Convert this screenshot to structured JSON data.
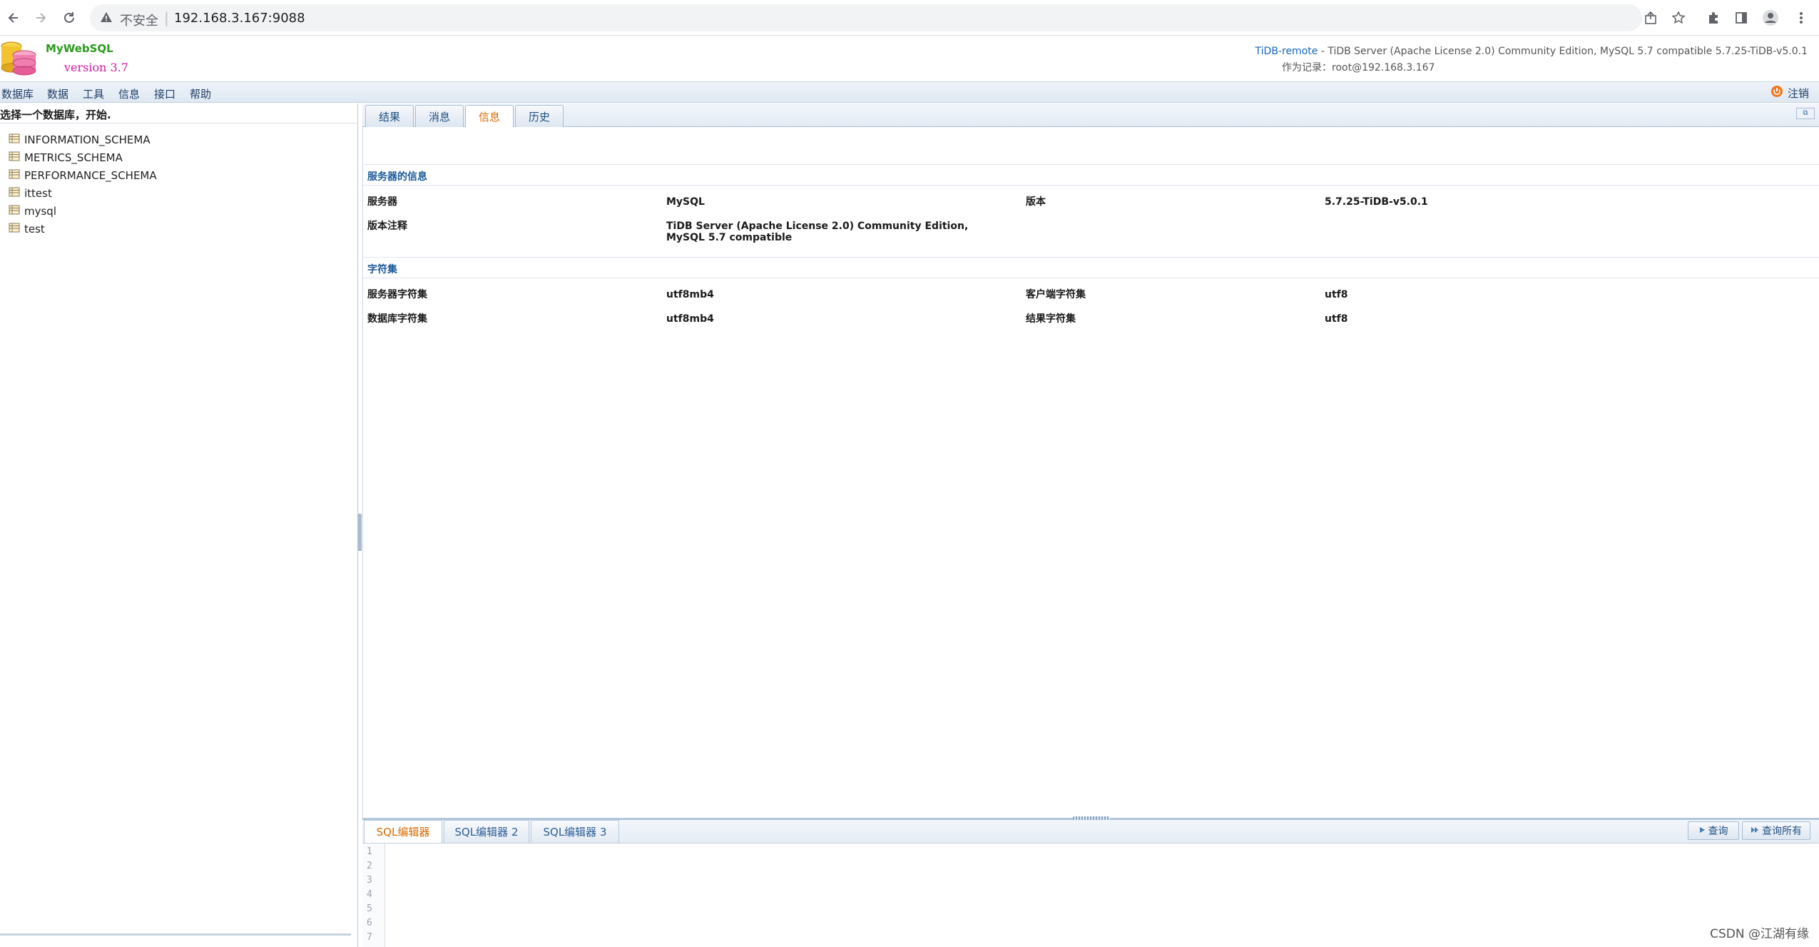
{
  "browser": {
    "insecure_label": "不安全",
    "url": "192.168.3.167:9088"
  },
  "app": {
    "name": "MyWebSQL",
    "version": "version 3.7",
    "connection_name": "TiDB-remote",
    "connection_desc": " - TiDB Server (Apache License 2.0) Community Edition, MySQL 5.7 compatible 5.7.25-TiDB-v5.0.1",
    "logged_in_as": "作为记录：root@192.168.3.167"
  },
  "menu": {
    "items": [
      "数据库",
      "数据",
      "工具",
      "信息",
      "接口",
      "帮助"
    ],
    "logout": "注销"
  },
  "left_panel": {
    "title": "选择一个数据库，开始.",
    "databases": [
      "INFORMATION_SCHEMA",
      "METRICS_SCHEMA",
      "PERFORMANCE_SCHEMA",
      "ittest",
      "mysql",
      "test"
    ]
  },
  "tabs": [
    "结果",
    "消息",
    "信息",
    "历史"
  ],
  "active_tab": "信息",
  "info": {
    "server_section": "服务器的信息",
    "server_label": "服务器",
    "server_value": "MySQL",
    "version_label": "版本",
    "version_value": "5.7.25-TiDB-v5.0.1",
    "version_comment_label": "版本注释",
    "version_comment_value": "TiDB Server (Apache License 2.0) Community Edition, MySQL 5.7 compatible",
    "charset_section": "字符集",
    "server_charset_label": "服务器字符集",
    "server_charset_value": "utf8mb4",
    "client_charset_label": "客户端字符集",
    "client_charset_value": "utf8",
    "db_charset_label": "数据库字符集",
    "db_charset_value": "utf8mb4",
    "result_charset_label": "结果字符集",
    "result_charset_value": "utf8"
  },
  "editor": {
    "tabs": [
      "SQL编辑器",
      "SQL编辑器 2",
      "SQL编辑器 3"
    ],
    "run_query": "查询",
    "run_all": "查询所有",
    "line_numbers": [
      "1",
      "2",
      "3",
      "4",
      "5",
      "6",
      "7"
    ]
  },
  "watermark": "CSDN @江湖有缘",
  "colors": {
    "active_tab": "#d86a00",
    "section_heading": "#1d5a99",
    "brand_green": "#2b9a1d",
    "brand_magenta": "#d11aa3",
    "link_blue": "#1565c0"
  }
}
